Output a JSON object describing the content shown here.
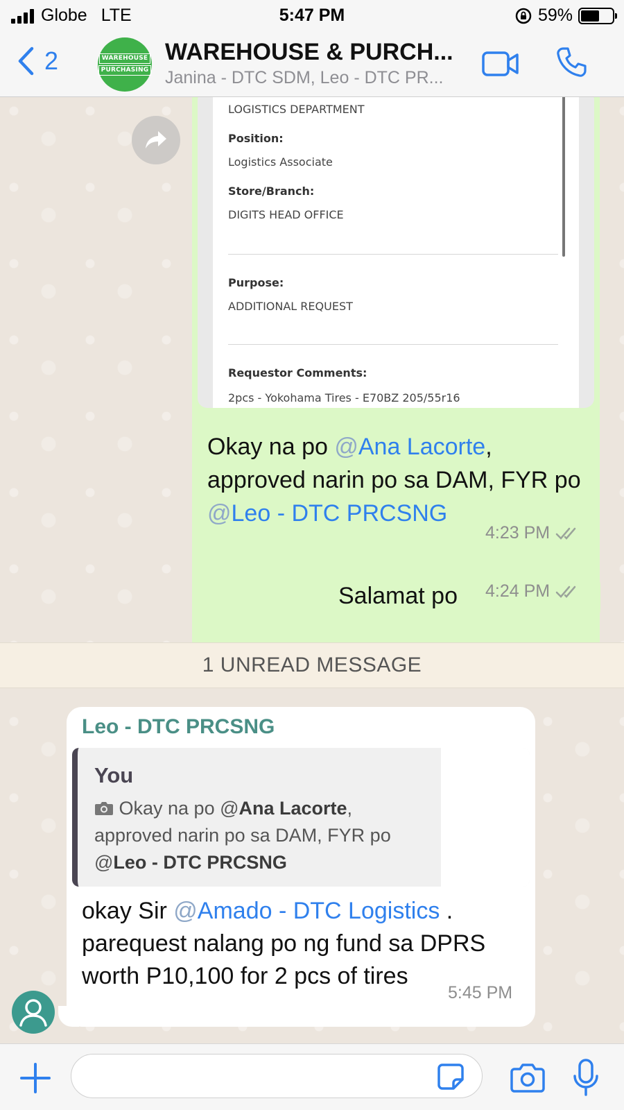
{
  "status_bar": {
    "carrier": "Globe",
    "network": "LTE",
    "time": "5:47 PM",
    "battery": "59%",
    "battery_level": 0.59
  },
  "header": {
    "back_count": "2",
    "avatar_text_1": "WAREHOUSE",
    "avatar_text_2": "PURCHASING",
    "title": "WAREHOUSE & PURCH...",
    "subtitle": "Janina - DTC SDM, Leo - DTC PR...",
    "accent_color": "#2f80ed"
  },
  "image_message": {
    "document": {
      "department_value": "LOGISTICS DEPARTMENT",
      "position_label": "Position:",
      "position_value": "Logistics Associate",
      "branch_label": "Store/Branch:",
      "branch_value": "DIGITS HEAD OFFICE",
      "purpose_label": "Purpose:",
      "purpose_value": "ADDITIONAL REQUEST",
      "comments_label": "Requestor Comments:",
      "comments_value": "2pcs - Yokohama Tires - E70BZ 205/55r16"
    },
    "caption_part1": "Okay na po ",
    "mention1_at": "@",
    "mention1": "Ana Lacorte",
    "caption_part2": ", approved narin po sa DAM, FYR po ",
    "mention2_at": "@",
    "mention2": "Leo - DTC PRCSNG",
    "time": "4:23 PM"
  },
  "short_message": {
    "text": "Salamat po",
    "time": "4:24 PM"
  },
  "unread_banner": "1 UNREAD MESSAGE",
  "incoming_message": {
    "sender": "Leo - DTC PRCSNG",
    "quote_author": "You",
    "quote_part1": " Okay na po @",
    "quote_mention1": "Ana Lacorte",
    "quote_part2": ", approved narin po sa DAM, FYR po @",
    "quote_mention2": "Leo - DTC PRCSNG",
    "text_part1": "okay Sir ",
    "mention_at": "@",
    "mention": "Amado - DTC Logistics",
    "text_part2": " . parequest nalang po ng fund sa DPRS worth P10,100 for 2 pcs of tires",
    "time": "5:45 PM"
  },
  "input_bar": {
    "placeholder": ""
  }
}
